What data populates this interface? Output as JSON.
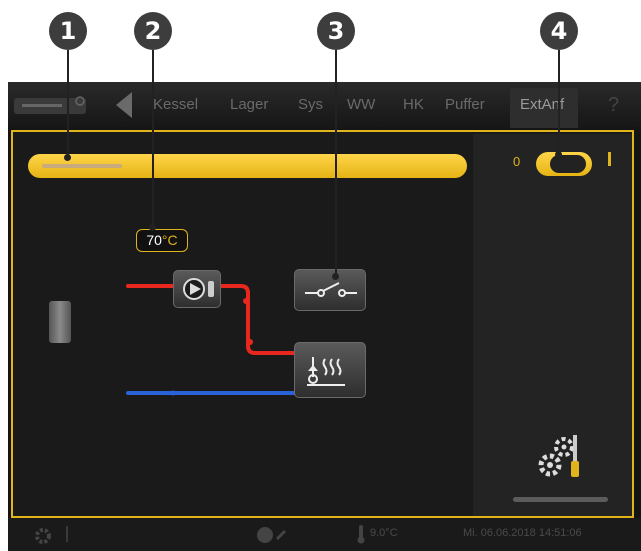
{
  "callouts": [
    "1",
    "2",
    "3",
    "4"
  ],
  "tabs": [
    "Kessel",
    "Lager",
    "Sys",
    "WW",
    "HK",
    "Puffer",
    "ExtAnf"
  ],
  "help_label": "?",
  "toggle": {
    "off_label": "0",
    "state": "on"
  },
  "temperature": {
    "value": "70",
    "unit": "°C"
  },
  "status_bar": {
    "outside_temp": "9.0°C",
    "datetime": "Mi. 06.06.2018 14:51:06"
  },
  "icons": {
    "logo": "eta-logo-icon",
    "back": "chevron-left-icon",
    "pump": "pump-icon",
    "switch": "switch-icon",
    "heater": "heat-demand-icon",
    "settings": "gears-wrench-icon",
    "status_settings": "gear-icon",
    "status_globe": "globe-icon",
    "status_thermo": "thermometer-icon"
  },
  "colors": {
    "accent": "#e0b41c",
    "flow": "#e8281e",
    "return": "#2a62d8"
  }
}
